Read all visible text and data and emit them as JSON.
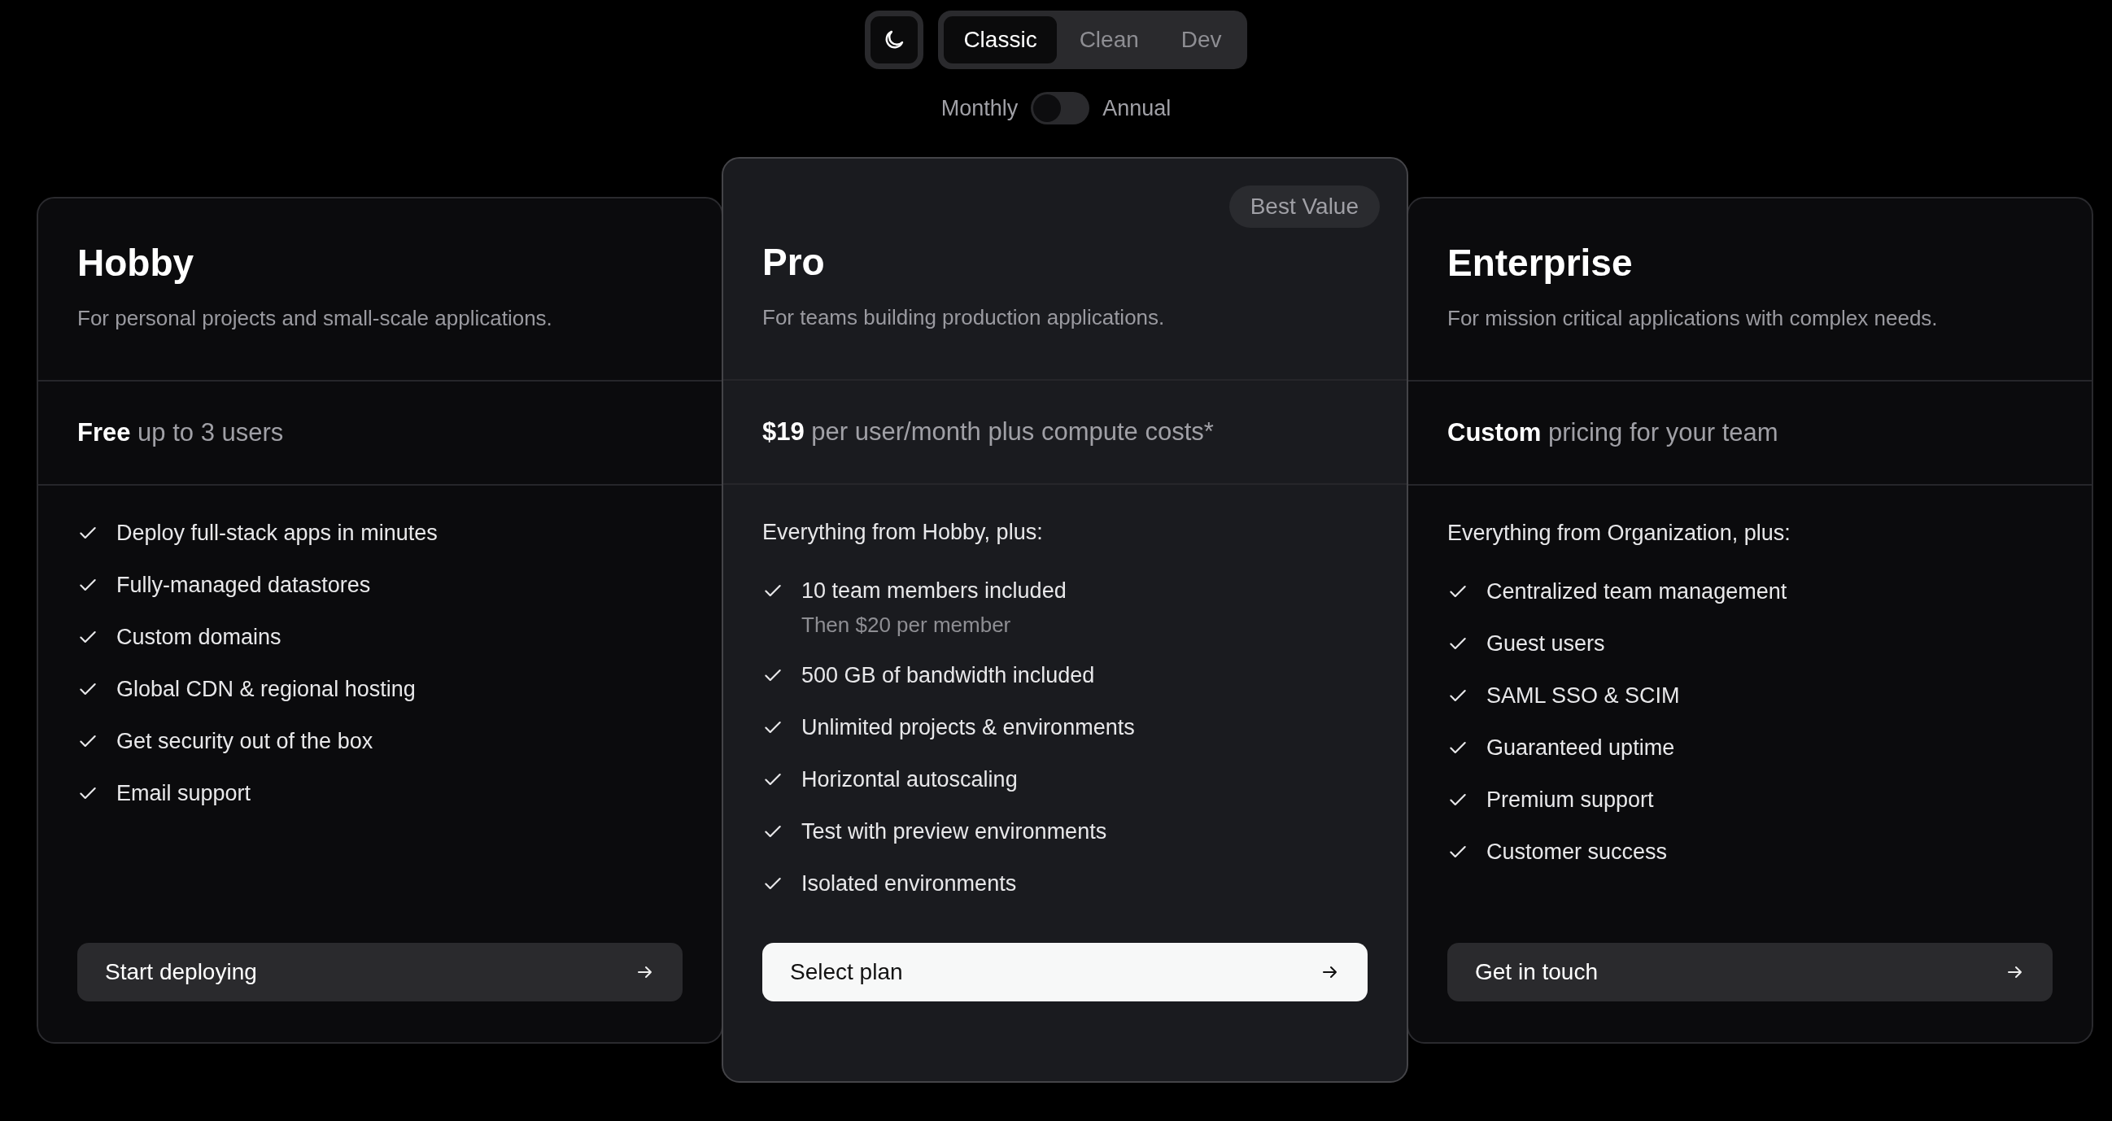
{
  "theme_tabs": [
    {
      "label": "Classic",
      "selected": true
    },
    {
      "label": "Clean",
      "selected": false
    },
    {
      "label": "Dev",
      "selected": false
    }
  ],
  "billing": {
    "left_label": "Monthly",
    "right_label": "Annual",
    "on": false
  },
  "plans": [
    {
      "name": "Hobby",
      "description": "For personal projects and small-scale applications.",
      "price": "**Free** up to 3 users",
      "highlighted": false,
      "features": [
        {
          "text": "Deploy full-stack apps in minutes"
        },
        {
          "text": "Fully-managed datastores"
        },
        {
          "text": "Custom domains"
        },
        {
          "text": "Global CDN & regional hosting"
        },
        {
          "text": "Get security out of the box"
        },
        {
          "text": "Email support"
        }
      ],
      "button": {
        "label": "Start deploying",
        "kind": "secondary"
      }
    },
    {
      "name": "Pro",
      "badge": "Best Value",
      "description": "For teams building production applications.",
      "price": "**$19** per user/month plus compute costs*",
      "highlighted": true,
      "intro": "Everything from Hobby, plus:",
      "features": [
        {
          "text": "10 team members included",
          "note": "Then $20 per member"
        },
        {
          "text": "500 GB of bandwidth included"
        },
        {
          "text": "Unlimited projects & environments"
        },
        {
          "text": "Horizontal autoscaling"
        },
        {
          "text": "Test with preview environments"
        },
        {
          "text": "Isolated environments"
        }
      ],
      "button": {
        "label": "Select plan",
        "kind": "primary"
      }
    },
    {
      "name": "Enterprise",
      "description": "For mission critical applications with complex needs.",
      "price": "**Custom** pricing for your team",
      "highlighted": false,
      "intro": "Everything from Organization, plus:",
      "features": [
        {
          "text": "Centralized team management"
        },
        {
          "text": "Guest users"
        },
        {
          "text": "SAML SSO & SCIM"
        },
        {
          "text": "Guaranteed uptime"
        },
        {
          "text": "Premium support"
        },
        {
          "text": "Customer success"
        }
      ],
      "button": {
        "label": "Get in touch",
        "kind": "secondary"
      }
    }
  ]
}
